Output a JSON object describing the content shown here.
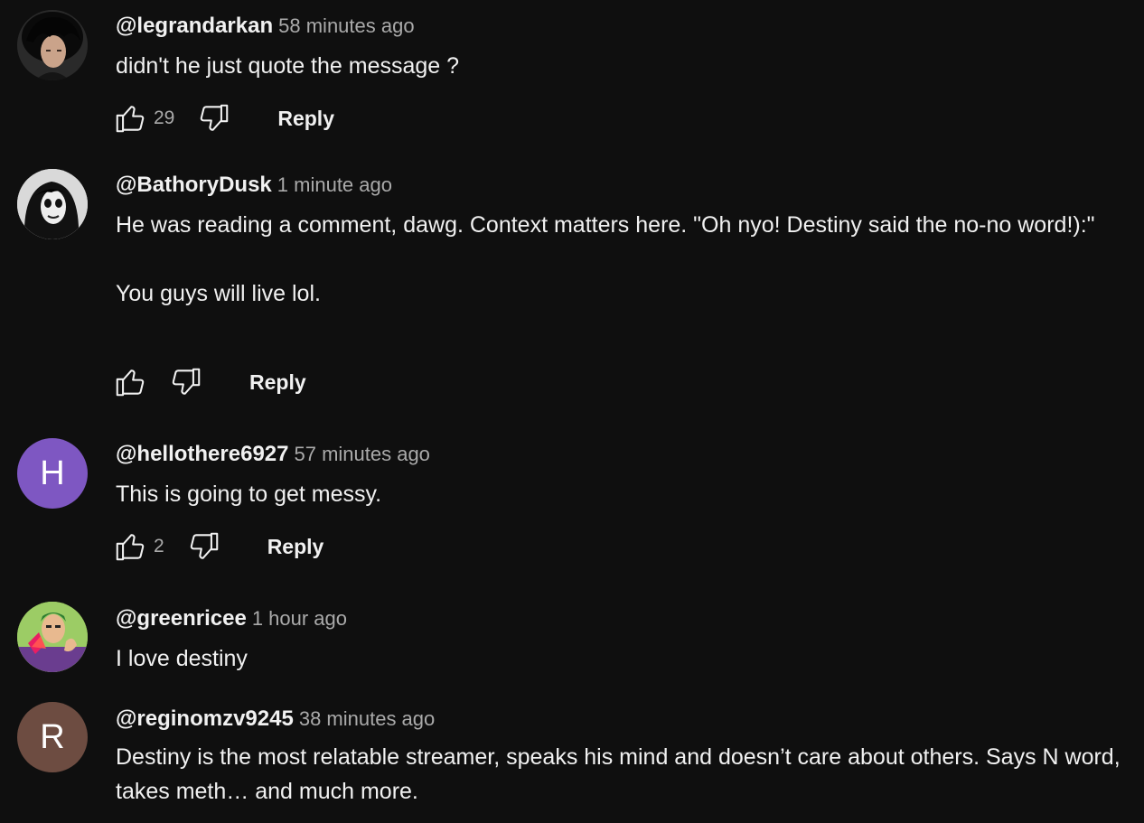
{
  "comments": [
    {
      "handle": "@legrandarkan",
      "time": "58 minutes ago",
      "text": "didn't he just quote the message ?",
      "likes": "29",
      "reply_label": "Reply",
      "avatar": {
        "type": "photo",
        "icon": "dark-hair-avatar-icon"
      }
    },
    {
      "handle": "@BathoryDusk",
      "time": "1 minute ago",
      "text": "He was reading a comment, dawg. Context matters here. \"Oh nyo! Destiny said the no-no word!):\"\n\nYou guys will live lol.",
      "likes": "",
      "reply_label": "Reply",
      "avatar": {
        "type": "photo",
        "icon": "face-paint-avatar-icon"
      }
    },
    {
      "handle": "@hellothere6927",
      "time": "57 minutes ago",
      "text": "This is going to get messy.",
      "likes": "2",
      "reply_label": "Reply",
      "avatar": {
        "type": "letter",
        "letter": "H",
        "color": "#7e57c2"
      }
    },
    {
      "handle": "@greenricee",
      "time": "1 hour ago",
      "text": "I love destiny",
      "avatar": {
        "type": "photo",
        "icon": "cartoon-character-avatar-icon"
      }
    },
    {
      "handle": "@reginomzv9245",
      "time": "38 minutes ago",
      "text": "Destiny is the most relatable streamer, speaks his mind and doesn’t care about others. Says N word, takes meth… and much more.",
      "avatar": {
        "type": "letter",
        "letter": "R",
        "color": "#6d4c41"
      }
    }
  ],
  "colors": {
    "background": "#0f0f0f",
    "text_primary": "#f1f1f1",
    "text_secondary": "#aaaaaa"
  }
}
